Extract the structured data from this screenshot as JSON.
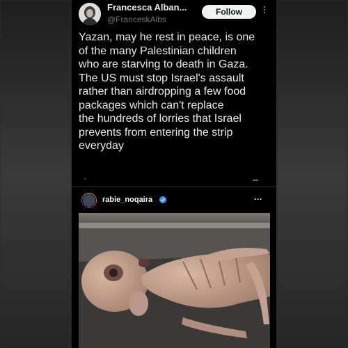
{
  "tweet": {
    "author": {
      "display_name": "Francesca Alban...",
      "handle": "@FranceskAlbs",
      "avatar_icon": "person-portrait-icon"
    },
    "follow_label": "Follow",
    "more_icon": "more-vertical-icon",
    "text_lines": [
      "Yazan, may he rest in peace, is one",
      "of the many Palestinian children",
      "who are starving to death in Gaza.",
      "The US must stop Israel's assault",
      "rather than airdropping a few food",
      "packages which can't replace",
      "the hundreds of lorries that Israel",
      "prevents from entering the strip",
      "everyday"
    ]
  },
  "embed": {
    "username": "rabie_noqaira",
    "verified_icon": "verified-badge-icon",
    "more_label": "···",
    "photo": "emaciated-child-photo"
  },
  "colors": {
    "background": "#000000",
    "text": "#e7e9ea",
    "secondary": "#71767b",
    "button_bg": "#eff3f4",
    "verified": "#3897f0"
  }
}
